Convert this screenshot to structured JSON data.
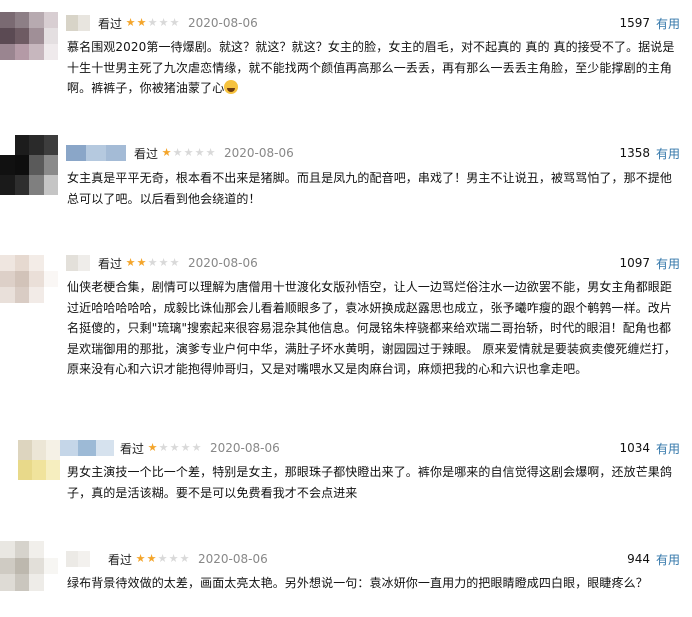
{
  "reviews": [
    {
      "watched": "看过",
      "rating": 2,
      "date": "2020-08-06",
      "votes": "1597",
      "useful": "有用",
      "text": "慕名围观2020第一待爆剧。就这？就这？就这？女主的脸，女主的眉毛，对不起真的 真的 真的接受不了。据说是十生十世男主死了九次虐恋情缘，就不能找两个颜值再高那么一丢丢，再有那么一丢丢主角脸，至少能撑剧的主角啊。裤裤子，你被猪油蒙了心"
    },
    {
      "watched": "看过",
      "rating": 1,
      "date": "2020-08-06",
      "votes": "1358",
      "useful": "有用",
      "text": "女主真是平平无奇，根本看不出来是猪脚。而且是凤九的配音吧，串戏了！男主不让说丑，被骂骂怕了，那不提他总可以了吧。以后看到他会绕道的！"
    },
    {
      "watched": "看过",
      "rating": 2,
      "date": "2020-08-06",
      "votes": "1097",
      "useful": "有用",
      "text": "仙侠老梗合集，剧情可以理解为唐僧用十世渡化女版孙悟空，让人一边骂烂俗注水一边欲罢不能，男女主角都眼距过近哈哈哈哈哈，成毅比诛仙那会儿看着顺眼多了，袁冰妍换成赵露思也成立，张予曦咋瘦的跟个鹌鹑一样。改片名挺傻的，只剩\"琉璃\"搜索起来很容易混杂其他信息。何晟铭朱梓骁都来给欢瑞二哥抬轿，时代的眼泪！配角也都是欢瑞御用的那批，演爹专业户何中华，满肚子坏水黄明，谢园园过于辣眼。 原来爱情就是要装疯卖傻死缠烂打，原来没有心和六识才能抱得帅哥归，又是对嘴喂水又是肉麻台词，麻烦把我的心和六识也拿走吧。"
    },
    {
      "watched": "看过",
      "rating": 1,
      "date": "2020-08-06",
      "votes": "1034",
      "useful": "有用",
      "text": "男女主演技一个比一个差，特别是女主，那眼珠子都快瞪出来了。裤你是哪来的自信觉得这剧会爆啊，还放芒果鸽子，真的是活该糊。要不是可以免费看我才不会点进来"
    },
    {
      "watched": "看过",
      "rating": 2,
      "date": "2020-08-06",
      "votes": "944",
      "useful": "有用",
      "text": "绿布背景待效做的太差，画面太亮太艳。另外想说一句：袁冰妍你一直用力的把眼睛瞪成四白眼，眼睫疼么？"
    }
  ],
  "colors": {
    "star_on": "#f4a52b",
    "star_off": "#d9d9d9",
    "link": "#3377aa",
    "date": "#888888"
  }
}
